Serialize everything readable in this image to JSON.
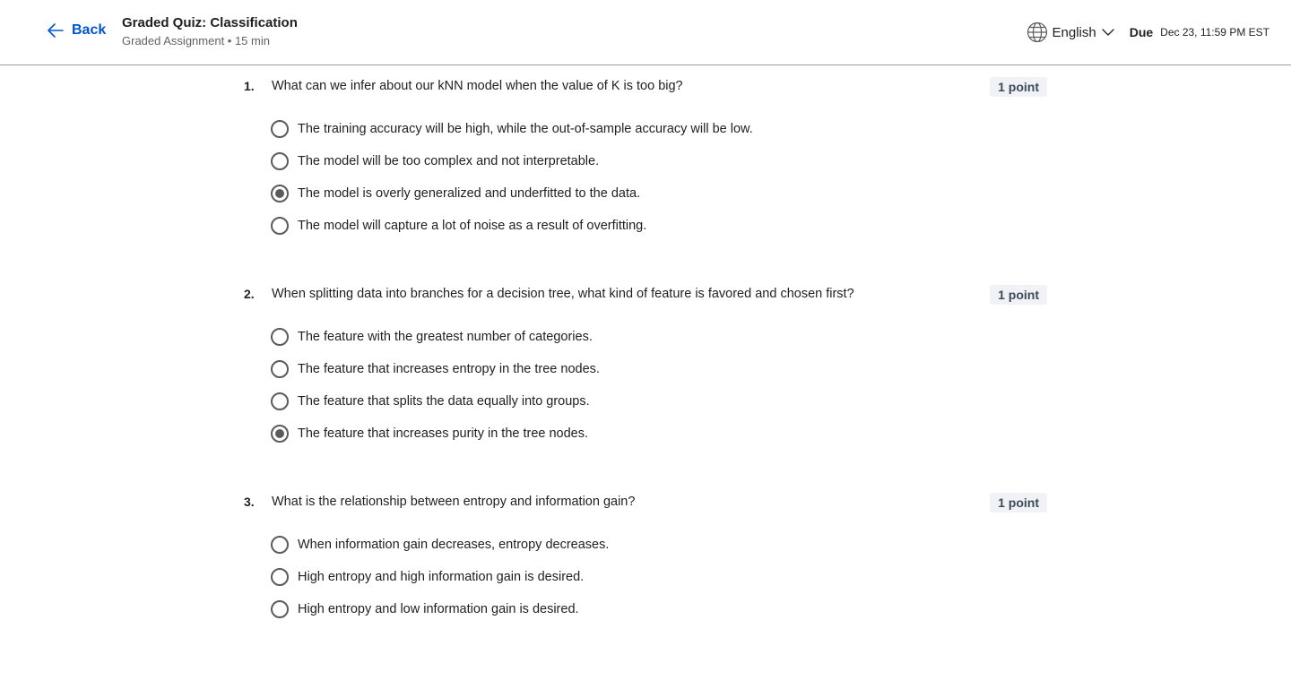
{
  "header": {
    "back_label": "Back",
    "title": "Graded Quiz: Classification",
    "subtitle": "Graded Assignment • 15 min",
    "language": "English",
    "due_label": "Due",
    "due_date": "Dec 23, 11:59 PM EST"
  },
  "colors": {
    "accent": "#0056d2",
    "points_badge_bg": "#f0f2f5"
  },
  "questions": [
    {
      "number": "1.",
      "text": "What can we infer about our kNN model when the value of K is too big?",
      "points": "1 point",
      "selected_index": 2,
      "options": [
        "The training accuracy will be high, while the out-of-sample accuracy will be low.",
        "The model will be too complex and not interpretable.",
        "The model is overly generalized and underfitted to the data.",
        "The model will capture a lot of noise as a result of overfitting."
      ]
    },
    {
      "number": "2.",
      "text": "When splitting data into branches for a decision tree, what kind of feature is favored and chosen first?",
      "points": "1 point",
      "selected_index": 3,
      "options": [
        "The feature with the greatest number of categories.",
        "The feature that increases entropy in the tree nodes.",
        "The feature that splits the data equally into groups.",
        "The feature that increases purity in the tree nodes."
      ]
    },
    {
      "number": "3.",
      "text": "What is the relationship between entropy and information gain?",
      "points": "1 point",
      "selected_index": null,
      "options": [
        "When information gain decreases, entropy decreases.",
        "High entropy and high information gain is desired.",
        "High entropy and low information gain is desired."
      ]
    }
  ]
}
